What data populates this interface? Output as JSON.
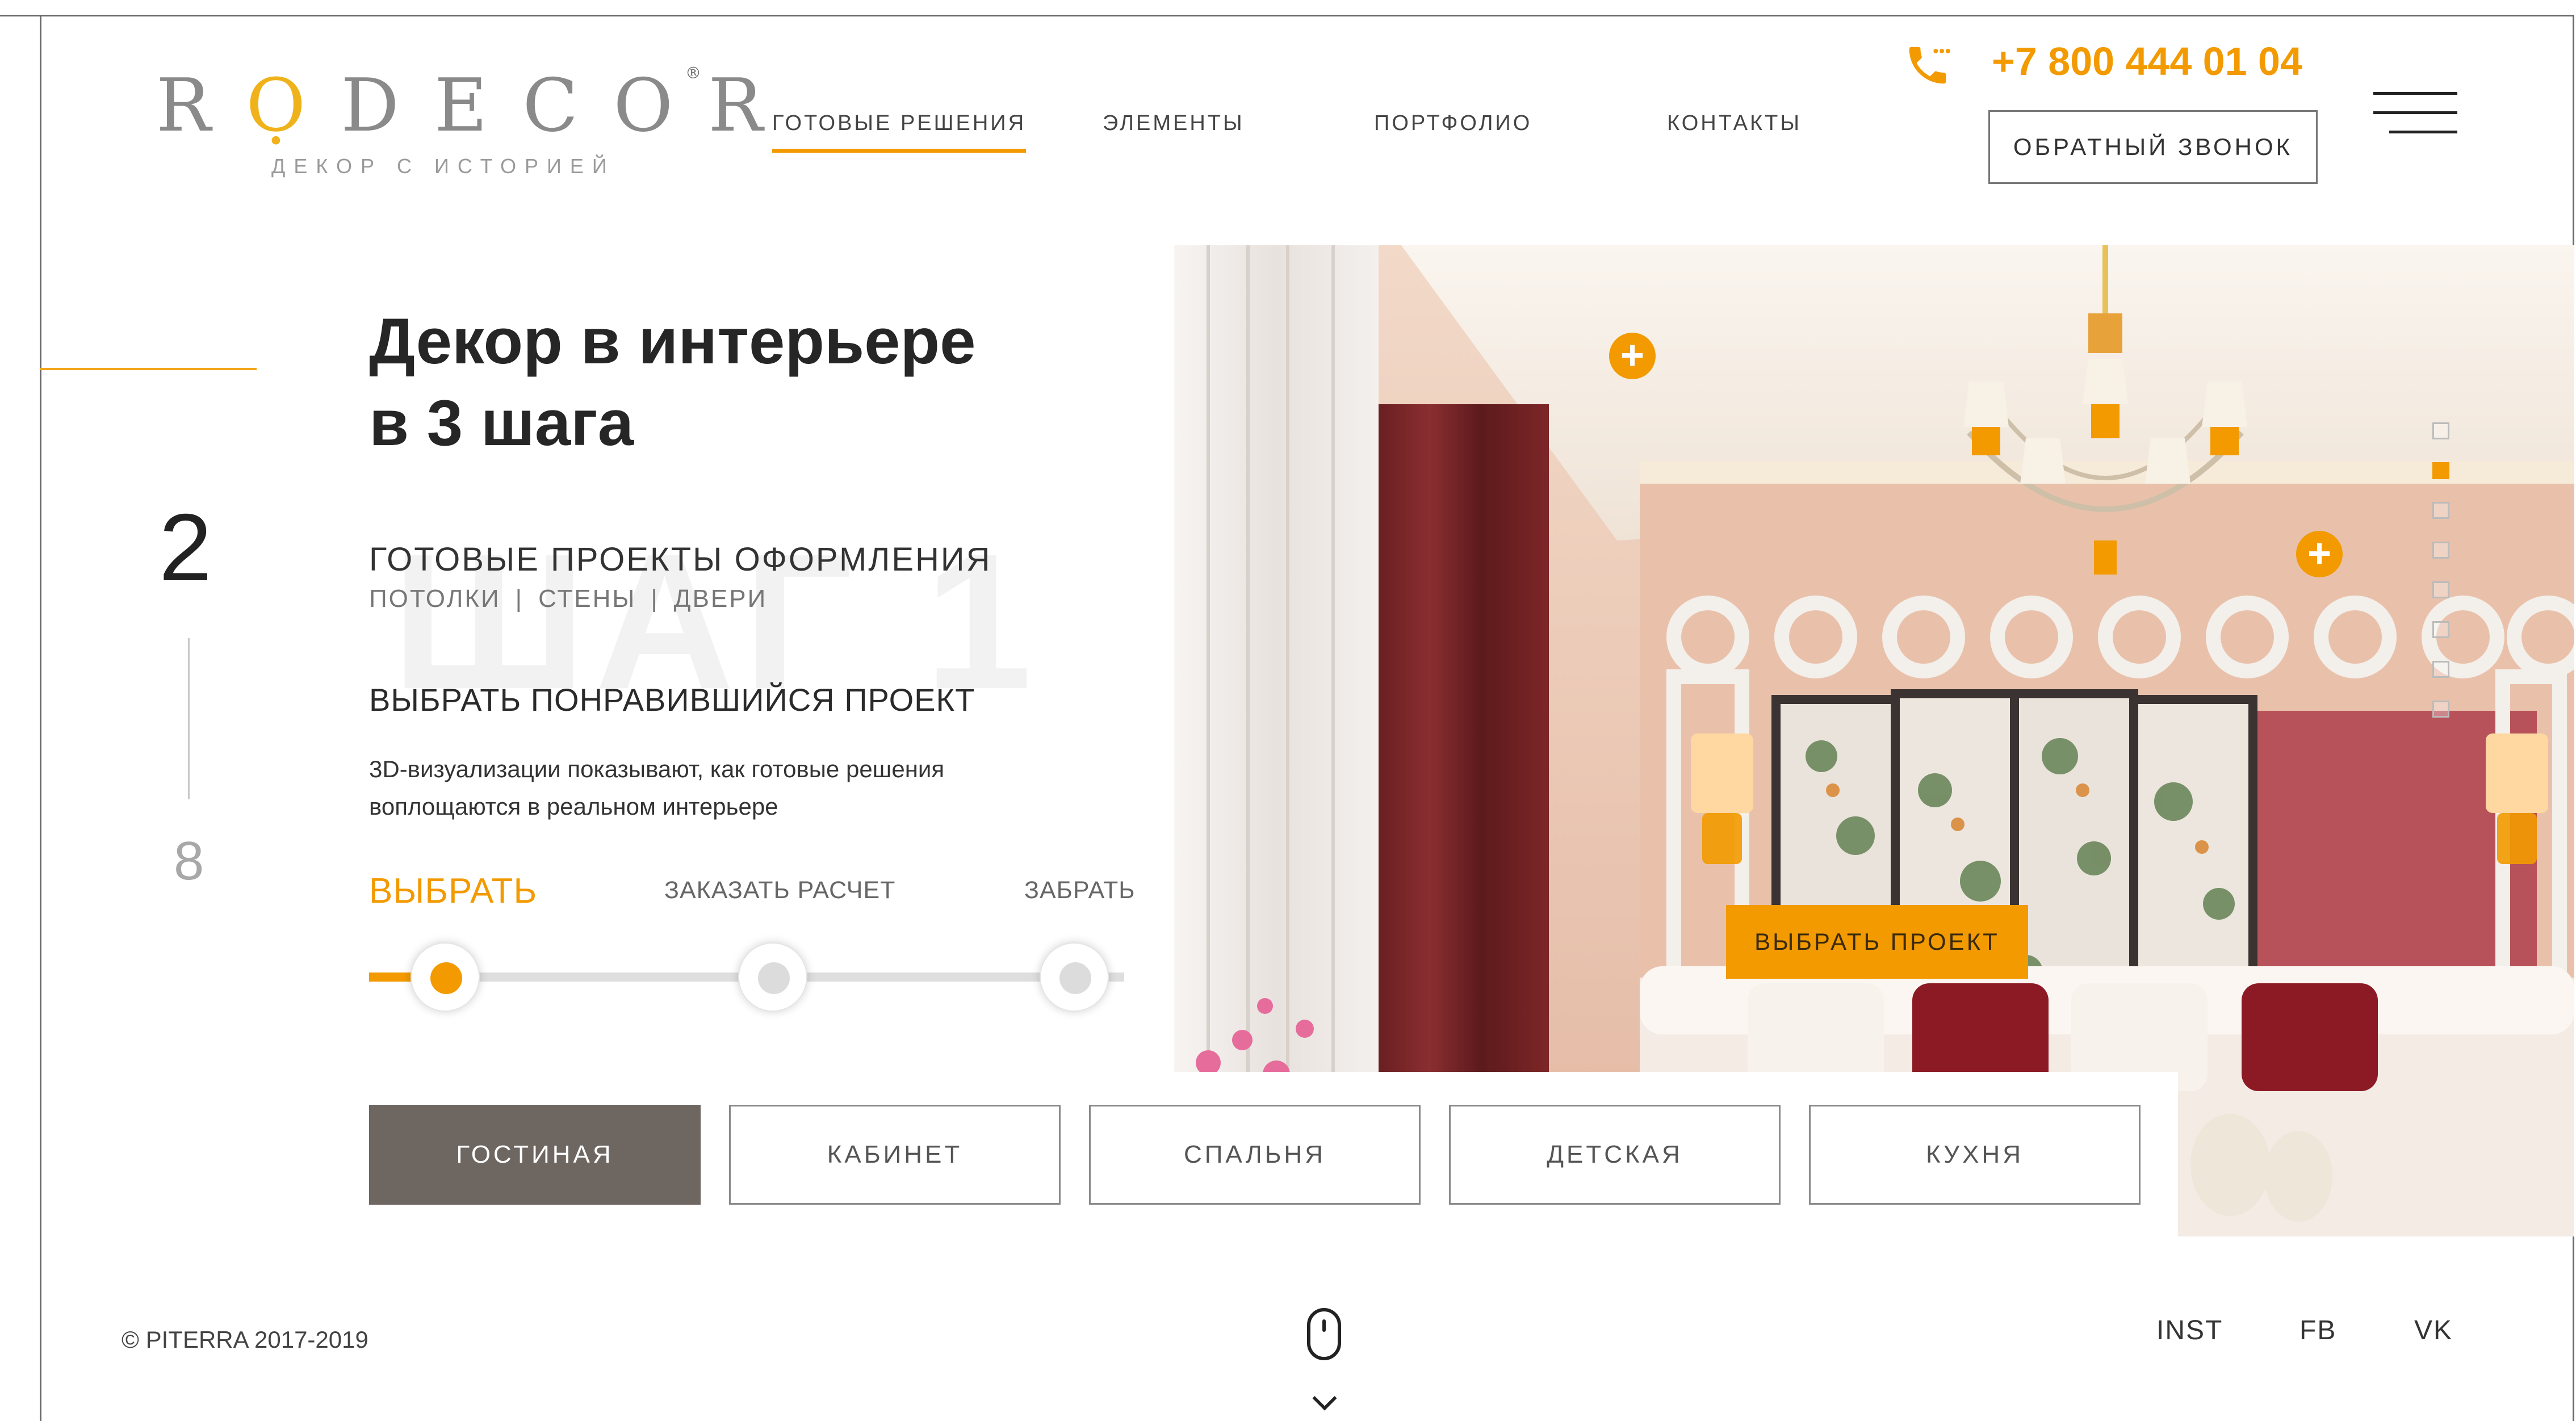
{
  "header": {
    "logo": {
      "letters": [
        "R",
        "Ọ",
        "D",
        "E",
        "C",
        "O",
        "R"
      ],
      "registered": "®",
      "tagline": "ДЕКОР С ИСТОРИЕЙ"
    },
    "nav": [
      {
        "label": "ГОТОВЫЕ РЕШЕНИЯ",
        "active": true
      },
      {
        "label": "ЭЛЕМЕНТЫ",
        "active": false
      },
      {
        "label": "ПОРТФОЛИО",
        "active": false
      },
      {
        "label": "КОНТАКТЫ",
        "active": false
      }
    ],
    "phone": "+7 800 444 01 04",
    "callback_label": "ОБРАТНЫЙ ЗВОНОК",
    "icons": {
      "phone": "phone-icon",
      "menu": "hamburger-menu-icon"
    }
  },
  "hero": {
    "step_current": "2",
    "step_total": "8",
    "title_line1": "Декор в интерьере",
    "title_line2": "в 3 шага",
    "background_word": "ШАГ 1",
    "subtitle": "ГОТОВЫЕ ПРОЕКТЫ ОФОРМЛЕНИЯ",
    "categories": [
      "ПОТОЛКИ",
      "СТЕНЫ",
      "ДВЕРИ"
    ],
    "category_separator": "|",
    "action_title": "ВЫБРАТЬ ПОНРАВИВШИЙСЯ ПРОЕКТ",
    "description_line1": "3D-визуализации показывают, как готовые решения",
    "description_line2": "воплощаются в реальном интерьере",
    "steps": [
      {
        "label": "ВЫБРАТЬ",
        "active": true
      },
      {
        "label": "ЗАКАЗАТЬ РАСЧЕТ",
        "active": false
      },
      {
        "label": "ЗАБРАТЬ",
        "active": false
      }
    ]
  },
  "gallery": {
    "choose_button": "ВЫБРАТЬ ПРОЕКТ",
    "hotspot_symbol": "+",
    "slides_total": 8,
    "slide_active_index": 1
  },
  "room_tabs": [
    {
      "label": "ГОСТИНАЯ",
      "active": true
    },
    {
      "label": "КАБИНЕТ",
      "active": false
    },
    {
      "label": "СПАЛЬНЯ",
      "active": false
    },
    {
      "label": "ДЕТСКАЯ",
      "active": false
    },
    {
      "label": "КУХНЯ",
      "active": false
    }
  ],
  "footer": {
    "copyright": "© PITERRA 2017-2019",
    "social": [
      "INST",
      "FB",
      "VK"
    ],
    "icons": {
      "scroll": "mouse-scroll-icon",
      "down": "chevron-down-icon"
    }
  },
  "colors": {
    "accent": "#f29a00",
    "logo_gold": "#f0b21a",
    "active_tab": "#6e6661",
    "text": "#2b2b2b"
  }
}
